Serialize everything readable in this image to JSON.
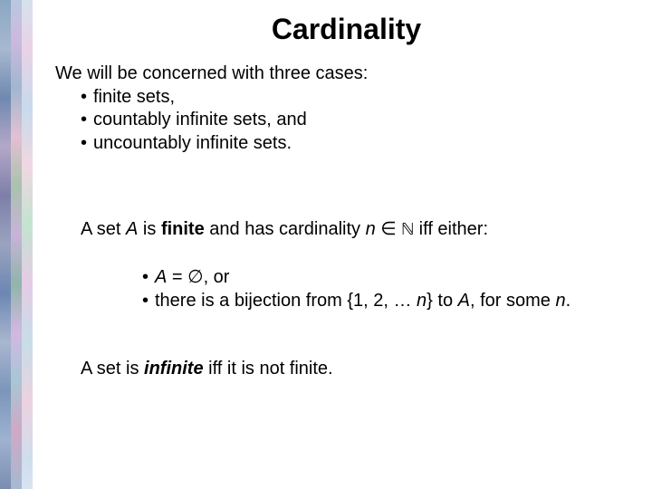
{
  "title": "Cardinality",
  "intro": "We will be concerned with three cases:",
  "bullets": {
    "b1": "finite sets,",
    "b2": "countably infinite sets, and",
    "b3": "uncountably infinite sets."
  },
  "def1": {
    "pre": "A set ",
    "A1": "A",
    "mid1": " is ",
    "finite": "finite",
    "mid2": " and has cardinality ",
    "n": "n",
    "in": " ∈ ",
    "N": "ℕ",
    "post": " iff either:"
  },
  "def1list": {
    "row1": {
      "A": "A",
      "eq": " = ",
      "empty": "∅",
      "post": ", or"
    },
    "row2": {
      "pre": "there is a bijection from {1, 2, … ",
      "n": "n",
      "mid": "} to ",
      "A": "A",
      "post": ", for some ",
      "n2": "n",
      "dot": "."
    }
  },
  "def2": {
    "pre": "A set is ",
    "inf": "infinite",
    "post": " iff it is not finite."
  },
  "dot": "•"
}
